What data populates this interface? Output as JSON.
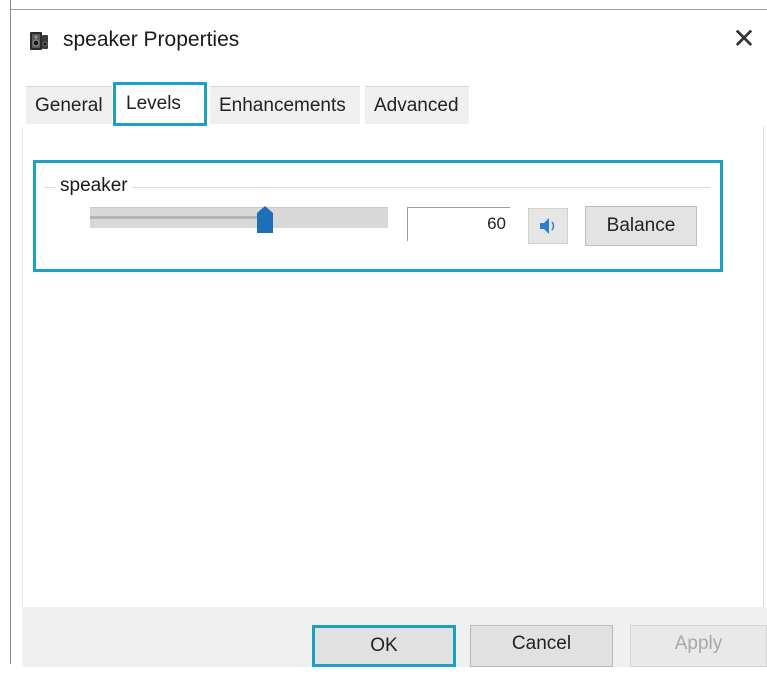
{
  "window": {
    "title": "speaker Properties",
    "icons": {
      "app": "speaker-properties-icon",
      "close": "close-icon"
    },
    "close_glyph": "✕"
  },
  "tabs": [
    {
      "label": "General",
      "selected": false
    },
    {
      "label": "Levels",
      "selected": true
    },
    {
      "label": "Enhancements",
      "selected": false
    },
    {
      "label": "Advanced",
      "selected": false
    }
  ],
  "levels": {
    "group_label": "speaker",
    "volume_value": "60",
    "slider_level_percent": 60,
    "mute_icon": "speaker-volume-icon",
    "balance_label": "Balance"
  },
  "footer": {
    "ok_label": "OK",
    "cancel_label": "Cancel",
    "apply_label": "Apply"
  },
  "colors": {
    "focus_accent": "#1b9fc6",
    "slider_thumb": "#1e6fb8",
    "disabled_text": "#a8a8a8"
  }
}
